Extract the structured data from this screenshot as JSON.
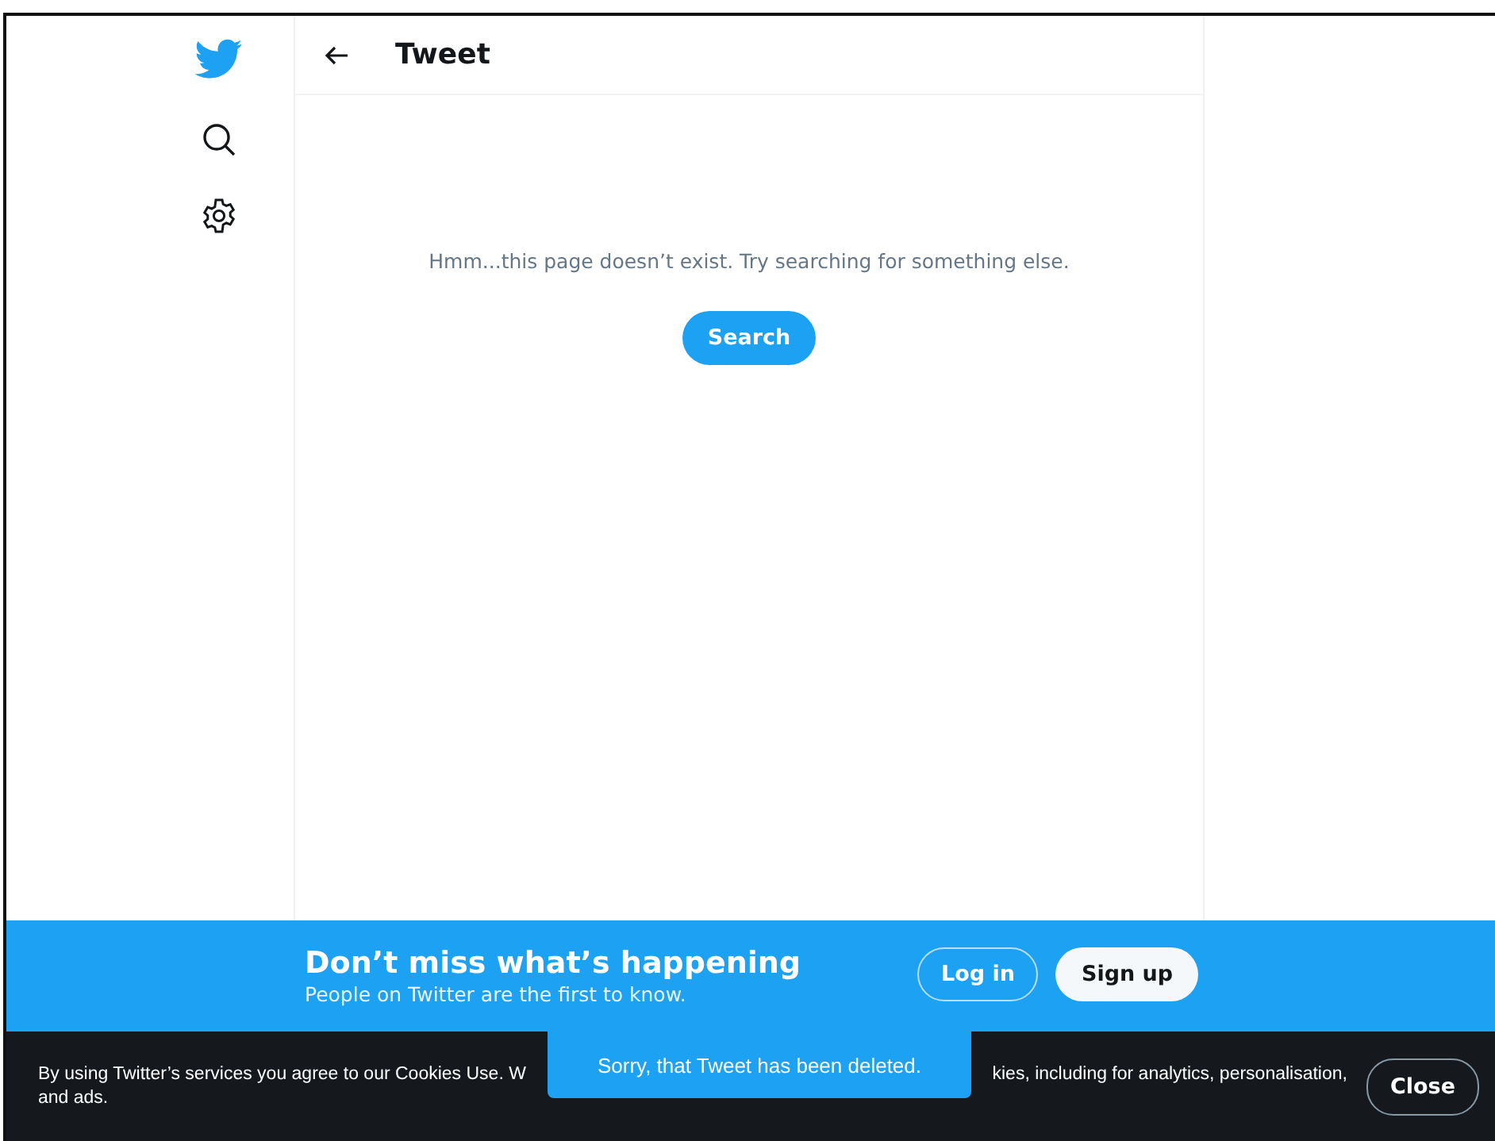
{
  "sidebar": {
    "items": [
      {
        "kind": "logo"
      },
      {
        "kind": "search"
      },
      {
        "kind": "settings"
      }
    ]
  },
  "header": {
    "title": "Tweet"
  },
  "message": {
    "text": "Hmm...this page doesn’t exist. Try searching for something else.",
    "button": "Search"
  },
  "banner": {
    "title": "Don’t miss what’s happening",
    "subtitle": "People on Twitter are the first to know.",
    "buttons": [
      {
        "kind": "outline",
        "label": "Log in"
      },
      {
        "kind": "filled",
        "label": "Sign up"
      }
    ]
  },
  "cookie_bar": {
    "text_parts": [
      "By using Twitter’s services you agree to our Cookies Use. W",
      "kies, including for analytics, personalisation,",
      "and ads."
    ],
    "close": "Close"
  },
  "toast": {
    "text": "Sorry, that Tweet has been deleted."
  }
}
